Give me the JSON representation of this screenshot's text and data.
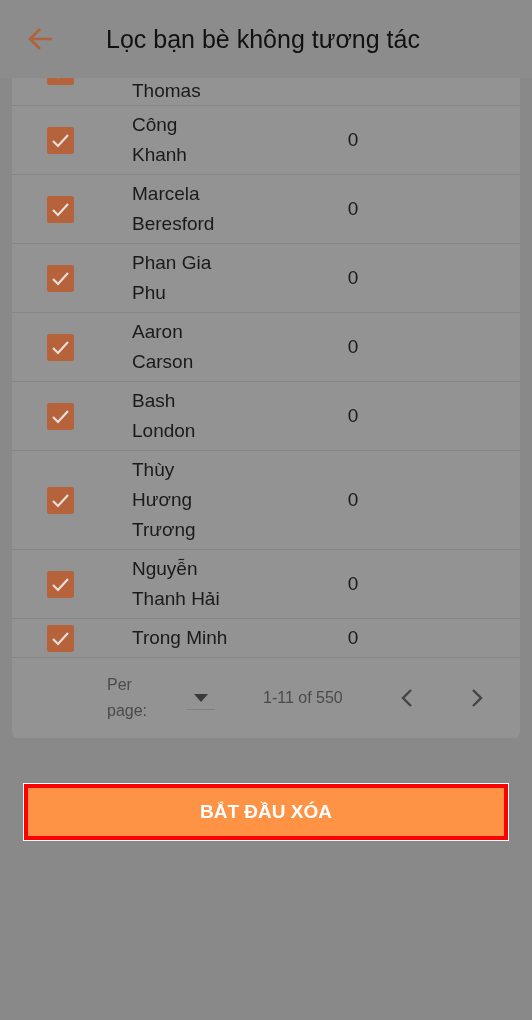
{
  "header": {
    "title": "Lọc bạn bè không tương tác"
  },
  "rows": [
    {
      "name": "Thomas",
      "checked": true
    },
    {
      "name": "Công Khanh",
      "count": "0",
      "checked": true
    },
    {
      "name": "Marcela Beresford",
      "count": "0",
      "checked": true
    },
    {
      "name": "Phan Gia Phu",
      "count": "0",
      "checked": true
    },
    {
      "name": "Aaron Carson",
      "count": "0",
      "checked": true
    },
    {
      "name": "Bash London",
      "count": "0",
      "checked": true
    },
    {
      "name": "Thùy Hương Trương",
      "count": "0",
      "checked": true
    },
    {
      "name": "Nguyễn Thanh Hải",
      "count": "0",
      "checked": true
    },
    {
      "name": "Trong Minh",
      "count": "0",
      "checked": true
    }
  ],
  "pagination": {
    "per_page_label": "Per page:",
    "range": "1-11 of 550"
  },
  "action_button": {
    "label": "BẮT ĐẦU XÓA",
    "highlighted": true
  }
}
